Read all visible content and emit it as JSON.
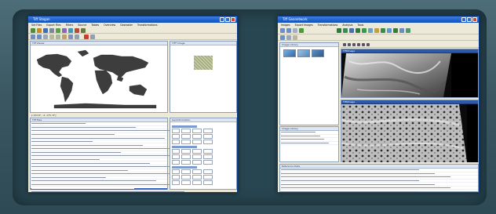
{
  "left_window": {
    "title": "Tiff Stegan",
    "menu": [
      "Set Files",
      "Export Files",
      "Filters",
      "Source",
      "Tables",
      "Overview",
      "Georaster",
      "Transformations"
    ],
    "panes": {
      "world": {
        "title": "Tiff Viewer"
      },
      "preview": {
        "title": "TIFF Image"
      },
      "files": {
        "title": "Tiff Files"
      },
      "info": {
        "title": "GeoInformation"
      }
    },
    "coords": "[-122.8°, -2, 175, 8°]"
  },
  "right_window": {
    "title": "Tiff Geonetwork",
    "menu": [
      "Images",
      "Export Images",
      "Transformations",
      "Analysis",
      "Tools"
    ],
    "panes": {
      "thumbs": {
        "title": "Image Library"
      },
      "top_image": {
        "title": "Tiff/Image"
      },
      "bottom_image": {
        "title": "Tiff/Image"
      },
      "list": {
        "title": "Image Library"
      },
      "status": "Reference Data"
    }
  }
}
